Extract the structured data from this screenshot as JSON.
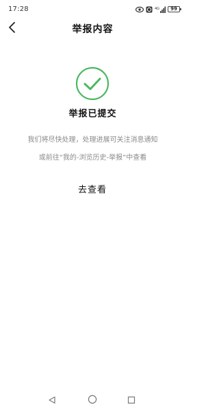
{
  "status_bar": {
    "time": "17:28",
    "battery": "99",
    "icons": [
      "eye-icon",
      "alarm-icon",
      "signal-icon",
      "battery-icon"
    ]
  },
  "header": {
    "back_icon": "back-arrow-icon",
    "title": "举报内容"
  },
  "result": {
    "icon": "check-circle-icon",
    "accent_color": "#4CB860",
    "title": "举报已提交",
    "desc_line1": "我们将尽快处理，处理进展可关注消息通知",
    "desc_line2": "或前往“我的-浏览历史-举报”中查看",
    "view_button": "去查看"
  },
  "nav_bar": {
    "keys": [
      "back-triangle-icon",
      "home-circle-icon",
      "recents-square-icon"
    ]
  }
}
